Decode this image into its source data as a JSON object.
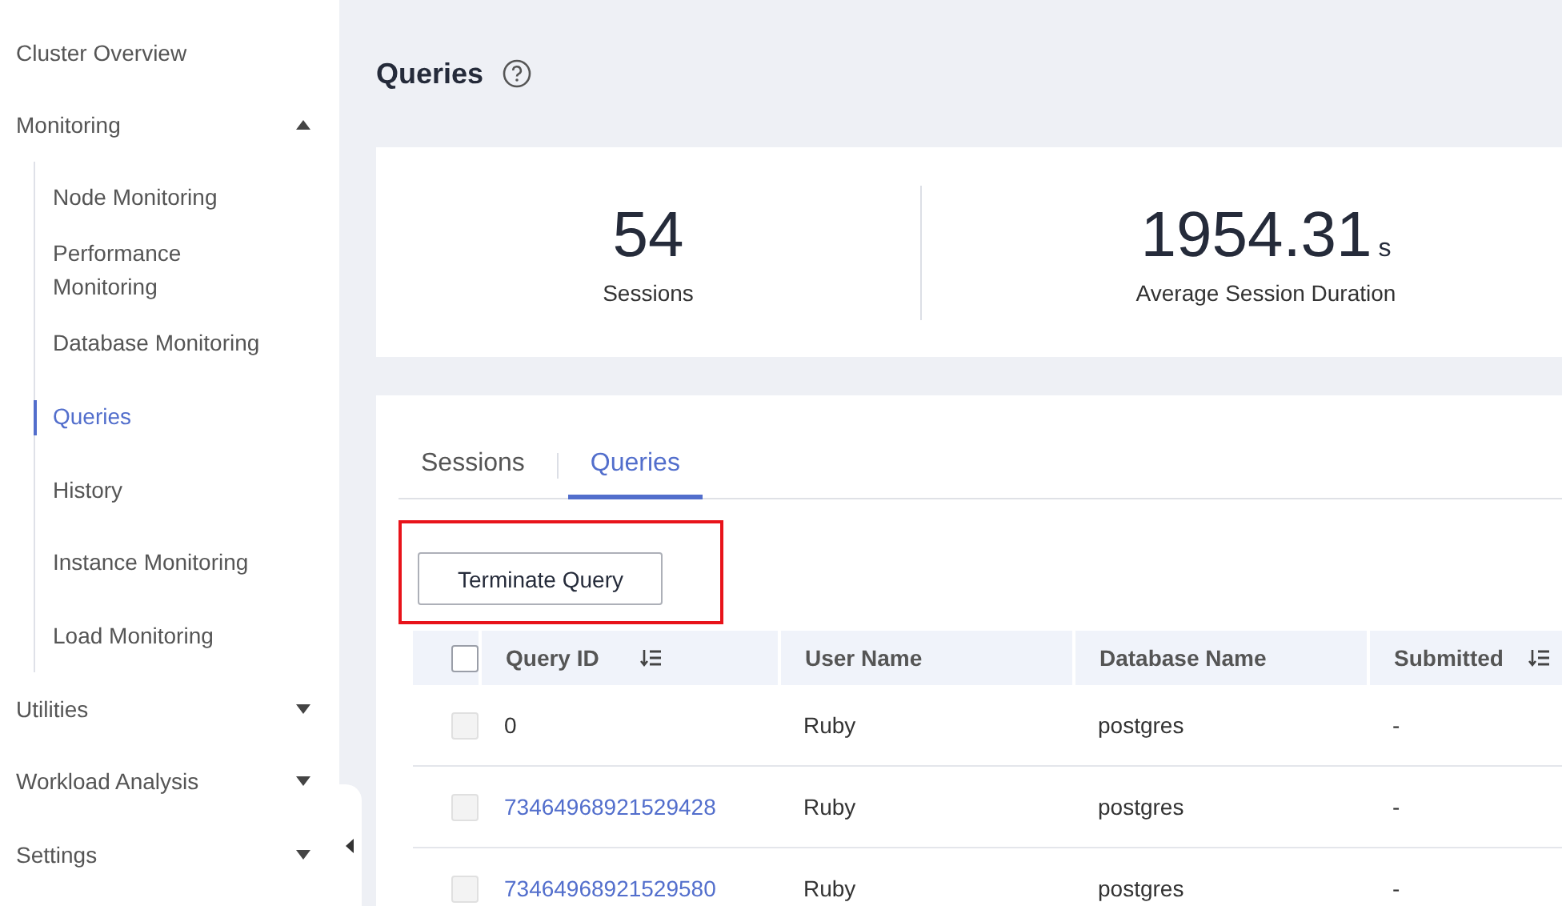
{
  "sidebar": {
    "items": [
      {
        "label": "Cluster Overview"
      },
      {
        "label": "Monitoring",
        "expanded": true,
        "children": [
          {
            "label": "Node Monitoring",
            "selected": false
          },
          {
            "label": "Performance Monitoring",
            "selected": false
          },
          {
            "label": "Database Monitoring",
            "selected": false
          },
          {
            "label": "Queries",
            "selected": true
          },
          {
            "label": "History",
            "selected": false
          },
          {
            "label": "Instance Monitoring",
            "selected": false
          },
          {
            "label": "Load Monitoring",
            "selected": false
          }
        ]
      },
      {
        "label": "Utilities",
        "expanded": false
      },
      {
        "label": "Workload Analysis",
        "expanded": false
      },
      {
        "label": "Settings",
        "expanded": false
      }
    ]
  },
  "page": {
    "title": "Queries"
  },
  "stats": [
    {
      "value": "54",
      "label": "Sessions"
    },
    {
      "value": "1954.31",
      "unit": "s",
      "label": "Average Session Duration"
    }
  ],
  "tabs": [
    {
      "label": "Sessions",
      "selected": false
    },
    {
      "label": "Queries",
      "selected": true
    }
  ],
  "toolbar": {
    "button": "Terminate Query",
    "highlighted": true
  },
  "table": {
    "header_checked": false,
    "columns": [
      {
        "label": "Query ID",
        "sortable": true
      },
      {
        "label": "User Name",
        "sortable": false
      },
      {
        "label": "Database Name",
        "sortable": false
      },
      {
        "label": "Submitted",
        "sortable": true
      }
    ],
    "rows": [
      {
        "disabled": true,
        "cells": [
          {
            "text": "0",
            "kind": "text"
          },
          {
            "text": "Ruby",
            "kind": "text"
          },
          {
            "text": "postgres",
            "kind": "text"
          },
          {
            "text": "-",
            "kind": "text"
          }
        ]
      },
      {
        "disabled": true,
        "cells": [
          {
            "text": "73464968921529428",
            "kind": "link"
          },
          {
            "text": "Ruby",
            "kind": "text"
          },
          {
            "text": "postgres",
            "kind": "text"
          },
          {
            "text": "-",
            "kind": "text"
          }
        ]
      },
      {
        "disabled": true,
        "cells": [
          {
            "text": "73464968921529580",
            "kind": "link"
          },
          {
            "text": "Ruby",
            "kind": "text"
          },
          {
            "text": "postgres",
            "kind": "text"
          },
          {
            "text": "-",
            "kind": "text"
          }
        ]
      }
    ]
  }
}
